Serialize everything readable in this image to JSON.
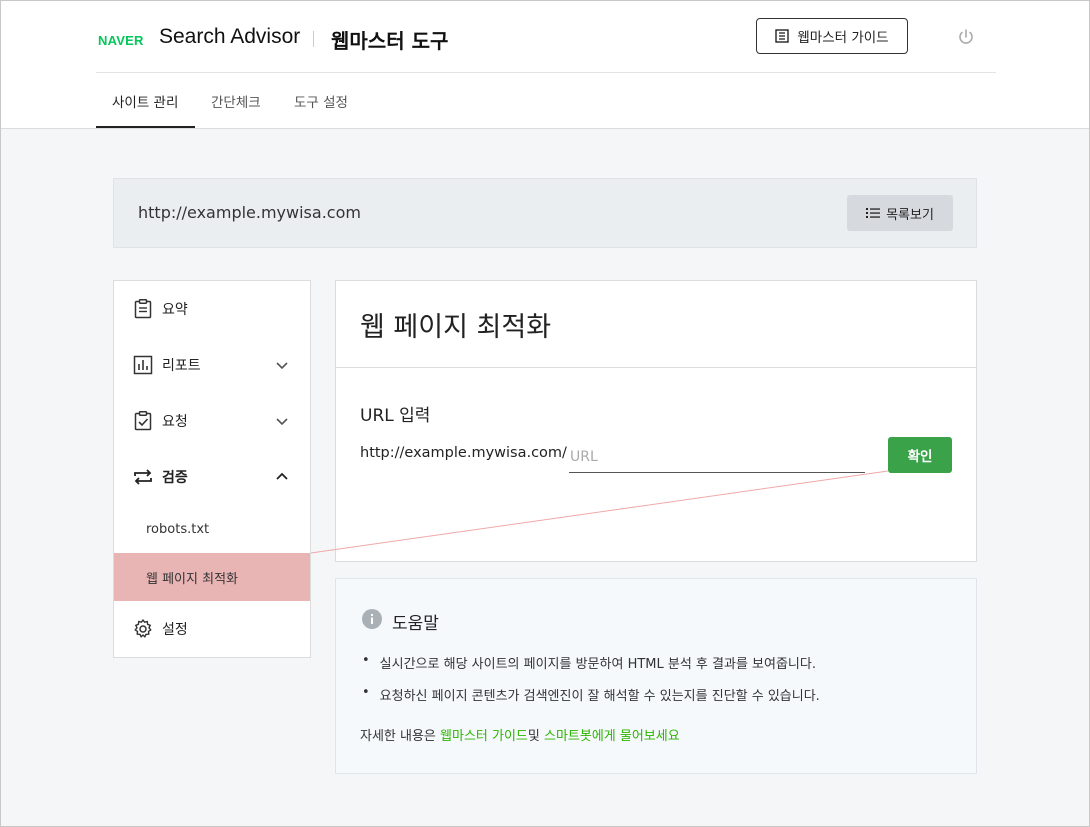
{
  "header": {
    "logo": "NAVER",
    "app_title": "Search Advisor",
    "section_title": "웹마스터 도구",
    "guide_button": "웹마스터 가이드",
    "icons": {
      "guide": "book-icon",
      "power": "power-icon"
    }
  },
  "tabs": [
    {
      "label": "사이트 관리",
      "active": true
    },
    {
      "label": "간단체크",
      "active": false
    },
    {
      "label": "도구 설정",
      "active": false
    }
  ],
  "site_bar": {
    "url": "http://example.mywisa.com",
    "list_button": "목록보기"
  },
  "sidebar": {
    "items": [
      {
        "label": "요약",
        "icon": "clipboard-icon"
      },
      {
        "label": "리포트",
        "icon": "bar-chart-icon",
        "expandable": true,
        "expanded": false
      },
      {
        "label": "요청",
        "icon": "clipboard-check-icon",
        "expandable": true,
        "expanded": false
      },
      {
        "label": "검증",
        "icon": "repeat-icon",
        "expandable": true,
        "expanded": true
      },
      {
        "label": "설정",
        "icon": "gear-icon"
      }
    ],
    "sub_items": [
      {
        "label": "robots.txt",
        "active": false
      },
      {
        "label": "웹 페이지 최적화",
        "active": true
      }
    ]
  },
  "main": {
    "page_title": "웹 페이지 최적화",
    "url_label": "URL 입력",
    "url_prefix": "http://example.mywisa.com/",
    "url_value": "",
    "url_placeholder": "URL",
    "confirm_button": "확인"
  },
  "help": {
    "title": "도움말",
    "bullets": [
      "실시간으로 해당 사이트의 페이지를 방문하여 HTML 분석 후 결과를 보여줍니다.",
      "요청하신 페이지 콘텐츠가 검색엔진이 잘 해석할 수 있는지를 진단할 수 있습니다."
    ],
    "footer_prefix": "자세한 내용은 ",
    "footer_link1": "웹마스터 가이드",
    "footer_mid": "및 ",
    "footer_link2": "스마트봇에게 물어보세요"
  },
  "colors": {
    "brand_green": "#03c75a",
    "confirm_green": "#3aa34a",
    "active_highlight": "#e8b4b4",
    "link_green": "#2db400"
  }
}
